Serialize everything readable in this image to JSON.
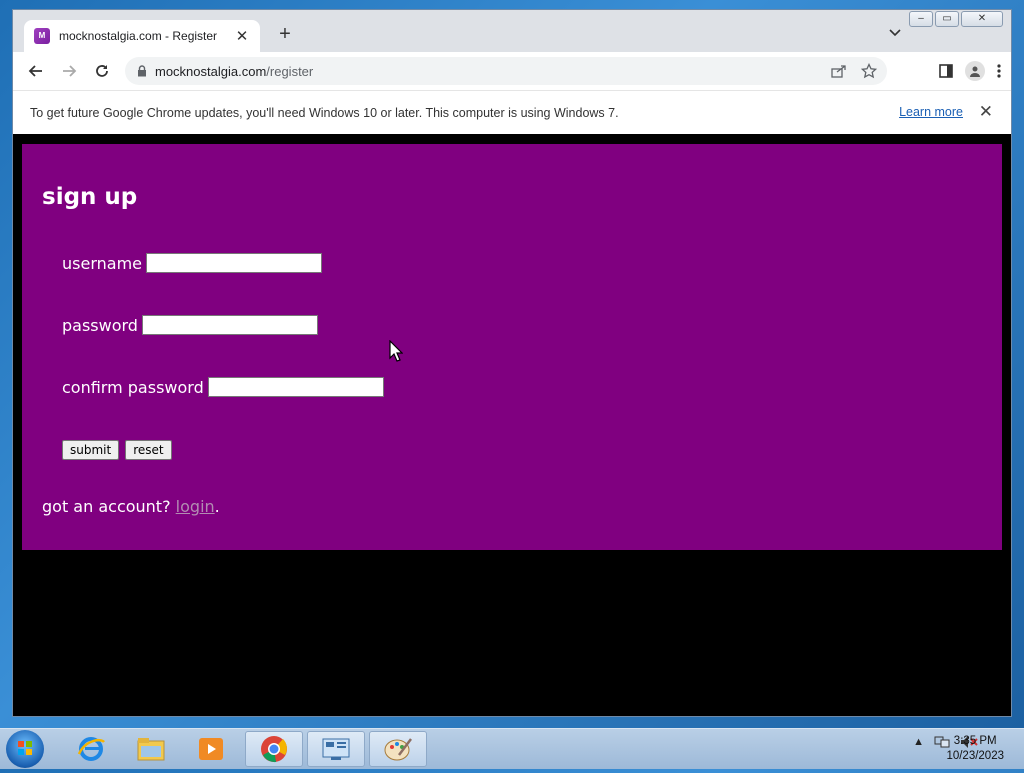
{
  "browser": {
    "tab_title": "mocknostalgia.com - Register",
    "favicon_text": "M",
    "url_domain": "mocknostalgia.com",
    "url_path": "/register",
    "infobar_text": "To get future Google Chrome updates, you'll need Windows 10 or later. This computer is using Windows 7.",
    "learn_more": "Learn more"
  },
  "page": {
    "heading": "sign up",
    "username_label": "username",
    "password_label": "password",
    "confirm_label": "confirm password",
    "submit_label": "submit",
    "reset_label": "reset",
    "account_prefix": "got an account?",
    "login_link": "login",
    "account_suffix": ".",
    "bg_color": "#800080"
  },
  "taskbar": {
    "time": "3:35 PM",
    "date": "10/23/2023"
  }
}
